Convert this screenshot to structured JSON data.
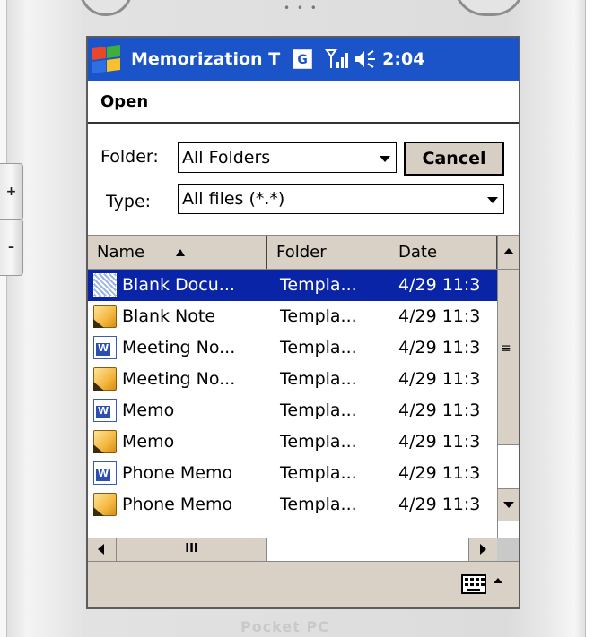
{
  "device": {
    "brand": "Pocket PC",
    "side_buttons": [
      "+",
      "–"
    ]
  },
  "titlebar": {
    "app_title": "Memorization T",
    "status_badge": "G",
    "clock": "2:04"
  },
  "menu": {
    "title": "Open"
  },
  "folder": {
    "label": "Folder:",
    "value": "All Folders",
    "cancel_label": "Cancel"
  },
  "type": {
    "label": "Type:",
    "value": "All files (*.*)"
  },
  "list": {
    "columns": [
      {
        "label": "Name",
        "sort": "ascending"
      },
      {
        "label": "Folder"
      },
      {
        "label": "Date"
      }
    ],
    "rows": [
      {
        "icon": "blank-document-icon",
        "name": "Blank Docu...",
        "folder": "Templa...",
        "date": "4/29 11:3",
        "selected": true
      },
      {
        "icon": "note-icon",
        "name": "Blank Note",
        "folder": "Templa...",
        "date": "4/29 11:3",
        "selected": false
      },
      {
        "icon": "word-document-icon",
        "name": "Meeting No...",
        "folder": "Templa...",
        "date": "4/29 11:3",
        "selected": false
      },
      {
        "icon": "note-icon",
        "name": "Meeting No...",
        "folder": "Templa...",
        "date": "4/29 11:3",
        "selected": false
      },
      {
        "icon": "word-document-icon",
        "name": "Memo",
        "folder": "Templa...",
        "date": "4/29 11:3",
        "selected": false
      },
      {
        "icon": "note-icon",
        "name": "Memo",
        "folder": "Templa...",
        "date": "4/29 11:3",
        "selected": false
      },
      {
        "icon": "word-document-icon",
        "name": "Phone Memo",
        "folder": "Templa...",
        "date": "4/29 11:3",
        "selected": false
      },
      {
        "icon": "note-icon",
        "name": "Phone Memo",
        "folder": "Templa...",
        "date": "4/29 11:3",
        "selected": false
      }
    ]
  },
  "scrollbars": {
    "horizontal_thumb_grip": "III",
    "vertical_thumb_grip": "≡"
  },
  "colors": {
    "titlebar": "#1a54c8",
    "selection": "#0a24a8",
    "chrome": "#d9d0c6"
  }
}
